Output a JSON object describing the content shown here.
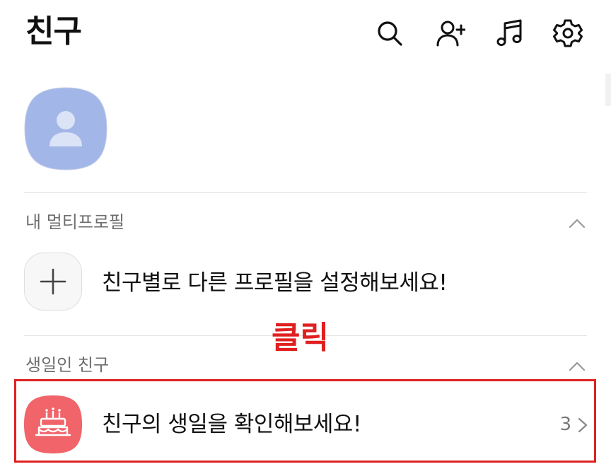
{
  "header": {
    "title": "친구",
    "icons": [
      "search-icon",
      "add-friend-icon",
      "music-icon",
      "settings-icon"
    ]
  },
  "multi_profile": {
    "section_label": "내 멀티프로필",
    "prompt": "친구별로 다른 프로필을 설정해보세요!"
  },
  "annotation": {
    "label": "클릭"
  },
  "birthday": {
    "section_label": "생일인 친구",
    "prompt": "친구의 생일을 확인해보세요!",
    "count": "3"
  },
  "colors": {
    "avatar_bg": "#a3b6e8",
    "cake_bg": "#f0646a",
    "annotation_red": "#e02020"
  }
}
